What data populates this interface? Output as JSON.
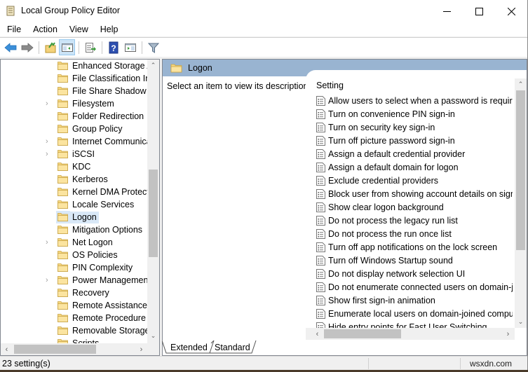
{
  "window": {
    "title": "Local Group Policy Editor",
    "controls": {
      "minimize": "minimize",
      "maximize": "maximize",
      "close": "close"
    }
  },
  "menu": [
    "File",
    "Action",
    "View",
    "Help"
  ],
  "toolbar": [
    {
      "icon": "back-arrow-icon",
      "label": "Back"
    },
    {
      "icon": "forward-arrow-icon",
      "label": "Forward"
    },
    {
      "icon": "up-folder-icon",
      "label": "Up one level"
    },
    {
      "icon": "show-hide-tree-icon",
      "label": "Show/Hide Console Tree",
      "active": true
    },
    {
      "icon": "export-list-icon",
      "label": "Export List"
    },
    {
      "icon": "help-icon",
      "label": "Help"
    },
    {
      "icon": "show-hide-action-pane-icon",
      "label": "Show/Hide Action Pane"
    },
    {
      "icon": "filter-icon",
      "label": "Filter Options"
    }
  ],
  "tree": {
    "items": [
      {
        "label": "Enhanced Storage A",
        "expandable": false
      },
      {
        "label": "File Classification Inf",
        "expandable": false
      },
      {
        "label": "File Share Shadow C",
        "expandable": false
      },
      {
        "label": "Filesystem",
        "expandable": true
      },
      {
        "label": "Folder Redirection",
        "expandable": false
      },
      {
        "label": "Group Policy",
        "expandable": false
      },
      {
        "label": "Internet Communica",
        "expandable": true
      },
      {
        "label": "iSCSI",
        "expandable": true
      },
      {
        "label": "KDC",
        "expandable": false
      },
      {
        "label": "Kerberos",
        "expandable": false
      },
      {
        "label": "Kernel DMA Protecti",
        "expandable": false
      },
      {
        "label": "Locale Services",
        "expandable": false
      },
      {
        "label": "Logon",
        "expandable": false,
        "selected": true
      },
      {
        "label": "Mitigation Options",
        "expandable": false
      },
      {
        "label": "Net Logon",
        "expandable": true
      },
      {
        "label": "OS Policies",
        "expandable": false
      },
      {
        "label": "PIN Complexity",
        "expandable": false
      },
      {
        "label": "Power Management",
        "expandable": true
      },
      {
        "label": "Recovery",
        "expandable": false
      },
      {
        "label": "Remote Assistance",
        "expandable": false
      },
      {
        "label": "Remote Procedure C",
        "expandable": false
      },
      {
        "label": "Removable Storage A",
        "expandable": false
      },
      {
        "label": "Scripts",
        "expandable": false
      }
    ]
  },
  "details": {
    "header_title": "Logon",
    "description": "Select an item to view its description.",
    "column_header": "Setting",
    "settings": [
      "Allow users to select when a password is required when resuming from connected standby",
      "Turn on convenience PIN sign-in",
      "Turn on security key sign-in",
      "Turn off picture password sign-in",
      "Assign a default credential provider",
      "Assign a default domain for logon",
      "Exclude credential providers",
      "Block user from showing account details on sign-in",
      "Show clear logon background",
      "Do not process the legacy run list",
      "Do not process the run once list",
      "Turn off app notifications on the lock screen",
      "Turn off Windows Startup sound",
      "Do not display network selection UI",
      "Do not enumerate connected users on domain-joined computers",
      "Show first sign-in animation",
      "Enumerate local users on domain-joined computers",
      "Hide entry points for Fast User Switching"
    ]
  },
  "tabs": [
    {
      "label": "Extended",
      "active": true
    },
    {
      "label": "Standard",
      "active": false
    }
  ],
  "status": {
    "text": "23 setting(s)",
    "watermark": "wsxdn.com"
  }
}
